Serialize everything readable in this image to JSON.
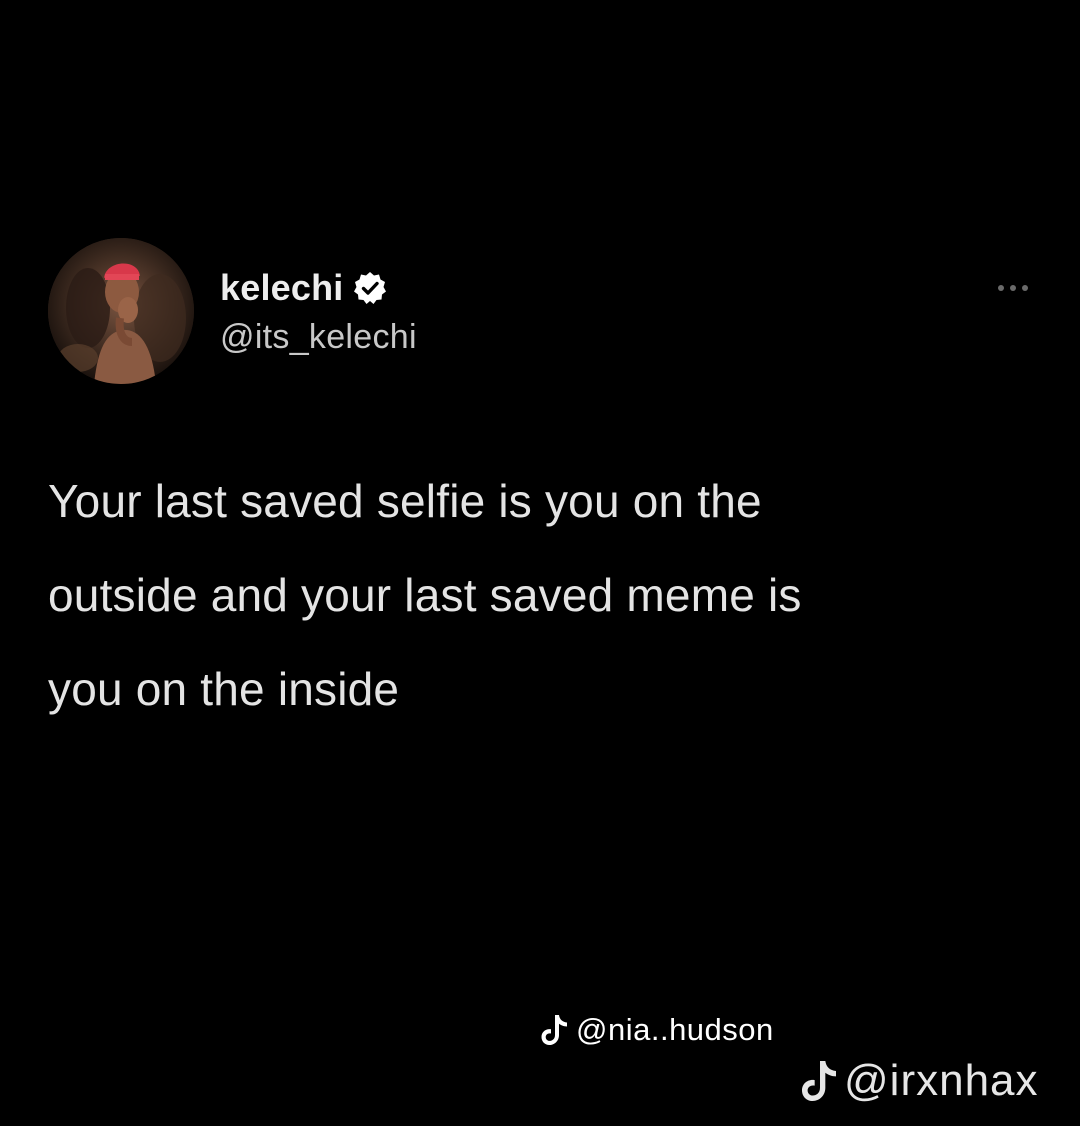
{
  "tweet": {
    "author": {
      "display_name": "kelechi",
      "handle": "@its_kelechi",
      "verified": true,
      "avatar_icon": "profile-photo"
    },
    "more_icon": "ellipsis-icon",
    "text_lines": [
      "Your last saved selfie is you on the",
      "outside and your last saved meme is",
      "you on the inside"
    ]
  },
  "watermarks": {
    "primary": {
      "icon": "tiktok-icon",
      "text": "@nia..hudson"
    },
    "secondary": {
      "icon": "tiktok-icon",
      "text": "@irxnhax"
    }
  },
  "colors": {
    "background": "#000000",
    "text": "#e4e4e4",
    "handle": "#c8c8c8",
    "badge": "#ffffff"
  }
}
